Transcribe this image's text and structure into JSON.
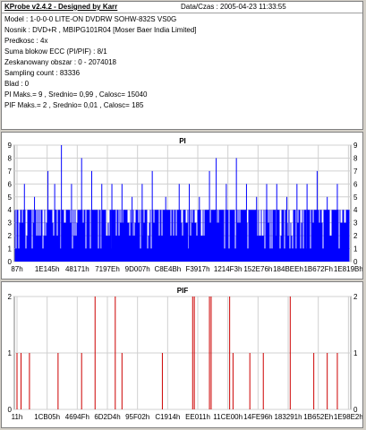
{
  "header": {
    "title": "KProbe v2.4.2 - Designed by Karr",
    "datetime": "Data/Czas : 2005-04-23 11:33:55"
  },
  "info_lines": [
    "Model : 1-0-0-0 LITE-ON DVDRW SOHW-832S  VS0G",
    "Nosnik : DVD+R , MBIPG101R04 [Moser Baer India Limited]",
    "Predkosc : 4x",
    "Suma blokow ECC (PI/PIF) : 8/1",
    "Zeskanowany obszar : 0 - 2074018",
    "Sampling count : 83336",
    "Blad : 0",
    "PI Maks.= 9 , Srednio= 0,99 , Calosc= 15040",
    "PIF Maks.= 2 , Srednio= 0,01 , Calosc= 185"
  ],
  "chart_data": [
    {
      "type": "bar",
      "title": "PI",
      "ylim": [
        0,
        9
      ],
      "yticks": [
        "0",
        "1",
        "2",
        "3",
        "4",
        "5",
        "6",
        "7",
        "8",
        "9"
      ],
      "xticks": [
        "87h",
        "1E145h",
        "48171h",
        "7197Eh",
        "9D007h",
        "C8E4Bh",
        "F3917h",
        "1214F3h",
        "152E76h",
        "184BEEh",
        "1B672Fh",
        "1E819Bh"
      ],
      "color": "#0000ff",
      "baseline": 4,
      "spikes": [
        [
          0.03,
          6
        ],
        [
          0.06,
          5
        ],
        [
          0.1,
          7
        ],
        [
          0.12,
          6
        ],
        [
          0.14,
          9
        ],
        [
          0.17,
          6
        ],
        [
          0.2,
          8
        ],
        [
          0.23,
          7
        ],
        [
          0.26,
          6
        ],
        [
          0.29,
          6
        ],
        [
          0.32,
          6
        ],
        [
          0.35,
          5
        ],
        [
          0.38,
          6
        ],
        [
          0.41,
          7
        ],
        [
          0.45,
          5
        ],
        [
          0.49,
          6
        ],
        [
          0.52,
          6
        ],
        [
          0.55,
          5
        ],
        [
          0.58,
          7
        ],
        [
          0.6,
          8
        ],
        [
          0.63,
          6
        ],
        [
          0.66,
          8
        ],
        [
          0.69,
          6
        ],
        [
          0.72,
          5
        ],
        [
          0.75,
          6
        ],
        [
          0.78,
          6
        ],
        [
          0.81,
          5
        ],
        [
          0.84,
          6
        ],
        [
          0.87,
          6
        ],
        [
          0.9,
          7
        ],
        [
          0.93,
          5
        ],
        [
          0.96,
          6
        ]
      ],
      "grid": true
    },
    {
      "type": "bar",
      "title": "PIF",
      "ylim": [
        0,
        2
      ],
      "yticks": [
        "0",
        "1",
        "2"
      ],
      "xticks": [
        "11h",
        "1CB05h",
        "4694Fh",
        "6D2D4h",
        "95F02h",
        "C1914h",
        "EE011h",
        "11CE00h",
        "14FE96h",
        "183291h",
        "1B652Eh",
        "1E98E2h"
      ],
      "color": "#cc0000",
      "spikes": [
        [
          0.008,
          1
        ],
        [
          0.02,
          1
        ],
        [
          0.045,
          1
        ],
        [
          0.13,
          1
        ],
        [
          0.2,
          1
        ],
        [
          0.24,
          2
        ],
        [
          0.3,
          2
        ],
        [
          0.32,
          1
        ],
        [
          0.44,
          1
        ],
        [
          0.53,
          2
        ],
        [
          0.535,
          2
        ],
        [
          0.58,
          2
        ],
        [
          0.585,
          2
        ],
        [
          0.64,
          2
        ],
        [
          0.65,
          1
        ],
        [
          0.7,
          1
        ],
        [
          0.74,
          1
        ],
        [
          0.82,
          2
        ],
        [
          0.89,
          1
        ],
        [
          0.93,
          1
        ],
        [
          0.96,
          1
        ]
      ],
      "grid": true
    }
  ]
}
